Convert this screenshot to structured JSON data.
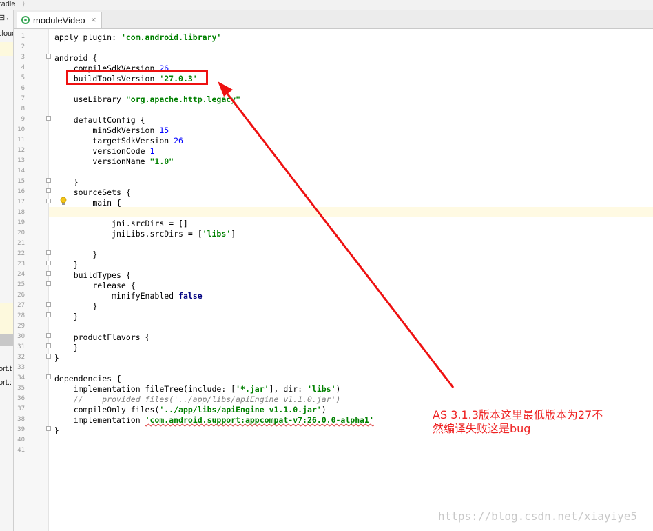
{
  "breadcrumb": {
    "label": "radle",
    "separator": "⟩"
  },
  "left_panel": {
    "items": [
      "cloud",
      "⊟←",
      "ort.t",
      "ort.:"
    ]
  },
  "tab": {
    "label": "moduleVideo",
    "close": "×",
    "icon": "android-module-icon"
  },
  "code": [
    {
      "n": "1",
      "fold": false,
      "tokens": [
        {
          "t": "apply plugin: ",
          "c": ""
        },
        {
          "t": "'com.android.library'",
          "c": "t-str"
        }
      ]
    },
    {
      "n": "2",
      "fold": false,
      "tokens": []
    },
    {
      "n": "3",
      "fold": true,
      "tokens": [
        {
          "t": "android {",
          "c": ""
        }
      ]
    },
    {
      "n": "4",
      "fold": false,
      "tokens": [
        {
          "t": "    compileSdkVersion ",
          "c": ""
        },
        {
          "t": "26",
          "c": "t-num"
        }
      ]
    },
    {
      "n": "5",
      "fold": false,
      "tokens": [
        {
          "t": "    buildToolsVersion ",
          "c": ""
        },
        {
          "t": "'27.0.3'",
          "c": "t-str"
        }
      ]
    },
    {
      "n": "6",
      "fold": false,
      "tokens": []
    },
    {
      "n": "7",
      "fold": false,
      "tokens": [
        {
          "t": "    useLibrary ",
          "c": ""
        },
        {
          "t": "\"org.apache.http.legacy\"",
          "c": "t-str"
        }
      ]
    },
    {
      "n": "8",
      "fold": false,
      "tokens": []
    },
    {
      "n": "9",
      "fold": true,
      "tokens": [
        {
          "t": "    defaultConfig {",
          "c": ""
        }
      ]
    },
    {
      "n": "10",
      "fold": false,
      "tokens": [
        {
          "t": "        minSdkVersion ",
          "c": ""
        },
        {
          "t": "15",
          "c": "t-num"
        }
      ]
    },
    {
      "n": "11",
      "fold": false,
      "tokens": [
        {
          "t": "        targetSdkVersion ",
          "c": ""
        },
        {
          "t": "26",
          "c": "t-num"
        }
      ]
    },
    {
      "n": "12",
      "fold": false,
      "tokens": [
        {
          "t": "        versionCode ",
          "c": ""
        },
        {
          "t": "1",
          "c": "t-num"
        }
      ]
    },
    {
      "n": "13",
      "fold": false,
      "tokens": [
        {
          "t": "        versionName ",
          "c": ""
        },
        {
          "t": "\"1.0\"",
          "c": "t-str"
        }
      ]
    },
    {
      "n": "14",
      "fold": false,
      "tokens": []
    },
    {
      "n": "15",
      "fold": true,
      "tokens": [
        {
          "t": "    }",
          "c": ""
        }
      ]
    },
    {
      "n": "16",
      "fold": true,
      "tokens": [
        {
          "t": "    sourceSets {",
          "c": ""
        }
      ]
    },
    {
      "n": "17",
      "fold": true,
      "tokens": [
        {
          "t": "        main {",
          "c": ""
        }
      ]
    },
    {
      "n": "18",
      "fold": false,
      "tokens": []
    },
    {
      "n": "19",
      "fold": false,
      "tokens": [
        {
          "t": "            jni.srcDirs = []",
          "c": ""
        }
      ]
    },
    {
      "n": "20",
      "fold": false,
      "tokens": [
        {
          "t": "            jniLibs.srcDirs = [",
          "c": ""
        },
        {
          "t": "'libs'",
          "c": "t-str"
        },
        {
          "t": "]",
          "c": ""
        }
      ]
    },
    {
      "n": "21",
      "fold": false,
      "tokens": []
    },
    {
      "n": "22",
      "fold": true,
      "tokens": [
        {
          "t": "        }",
          "c": ""
        }
      ]
    },
    {
      "n": "23",
      "fold": true,
      "tokens": [
        {
          "t": "    }",
          "c": ""
        }
      ]
    },
    {
      "n": "24",
      "fold": true,
      "tokens": [
        {
          "t": "    buildTypes {",
          "c": ""
        }
      ]
    },
    {
      "n": "25",
      "fold": true,
      "tokens": [
        {
          "t": "        release {",
          "c": ""
        }
      ]
    },
    {
      "n": "26",
      "fold": false,
      "tokens": [
        {
          "t": "            minifyEnabled ",
          "c": ""
        },
        {
          "t": "false",
          "c": "t-kw"
        }
      ]
    },
    {
      "n": "27",
      "fold": true,
      "tokens": [
        {
          "t": "        }",
          "c": ""
        }
      ]
    },
    {
      "n": "28",
      "fold": true,
      "tokens": [
        {
          "t": "    }",
          "c": ""
        }
      ]
    },
    {
      "n": "29",
      "fold": false,
      "tokens": []
    },
    {
      "n": "30",
      "fold": true,
      "tokens": [
        {
          "t": "    productFlavors {",
          "c": ""
        }
      ]
    },
    {
      "n": "31",
      "fold": true,
      "tokens": [
        {
          "t": "    }",
          "c": ""
        }
      ]
    },
    {
      "n": "32",
      "fold": true,
      "tokens": [
        {
          "t": "}",
          "c": ""
        }
      ]
    },
    {
      "n": "33",
      "fold": false,
      "tokens": []
    },
    {
      "n": "34",
      "fold": true,
      "tokens": [
        {
          "t": "dependencies {",
          "c": ""
        }
      ]
    },
    {
      "n": "35",
      "fold": false,
      "tokens": [
        {
          "t": "    implementation fileTree(include: [",
          "c": ""
        },
        {
          "t": "'*.jar'",
          "c": "t-str"
        },
        {
          "t": "], dir: ",
          "c": ""
        },
        {
          "t": "'libs'",
          "c": "t-str"
        },
        {
          "t": ")",
          "c": ""
        }
      ]
    },
    {
      "n": "36",
      "fold": false,
      "tokens": [
        {
          "t": "    //    provided files('../app/libs/apiEngine v1.1.0.jar')",
          "c": "t-cmt"
        }
      ]
    },
    {
      "n": "37",
      "fold": false,
      "tokens": [
        {
          "t": "    compileOnly files(",
          "c": ""
        },
        {
          "t": "'../app/libs/apiEngine v1.1.0.jar'",
          "c": "t-str"
        },
        {
          "t": ")",
          "c": ""
        }
      ]
    },
    {
      "n": "38",
      "fold": false,
      "tokens": [
        {
          "t": "    implementation ",
          "c": ""
        },
        {
          "t": "'com.android.support:appcompat-v7:26.0.0-alpha1'",
          "c": "t-str t-und"
        }
      ]
    },
    {
      "n": "39",
      "fold": true,
      "tokens": [
        {
          "t": "}",
          "c": ""
        }
      ]
    },
    {
      "n": "40",
      "fold": false,
      "tokens": []
    },
    {
      "n": "41",
      "fold": false,
      "tokens": []
    }
  ],
  "current_line": "18",
  "annotation": {
    "line1": "AS 3.1.3版本这里最低版本为27不",
    "line2": "然编译失败这是bug"
  },
  "watermark": "https://blog.csdn.net/xiayiye5",
  "colors": {
    "annotation": "#ee2222",
    "highlight_box": "#ee1111",
    "arrow": "#ee1111"
  }
}
